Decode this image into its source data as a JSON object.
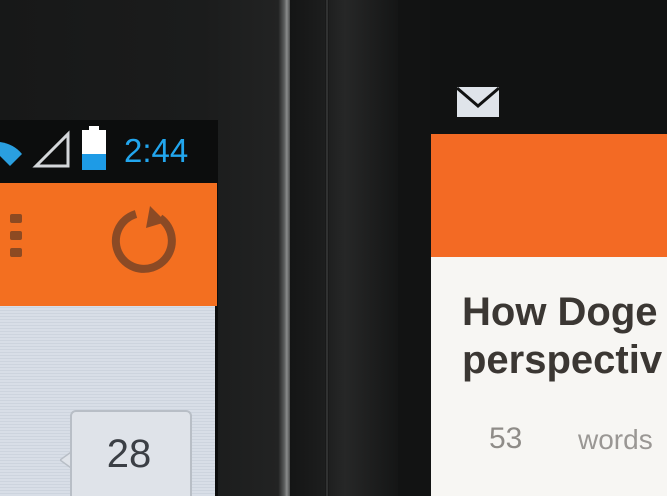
{
  "left_phone": {
    "status_bar": {
      "time": "2:44",
      "icons": [
        "wifi-icon",
        "signal-icon",
        "battery-icon"
      ],
      "time_color": "#22a6ee"
    },
    "toolbar": {
      "color": "#f36f20",
      "icons": [
        "overflow-menu-icon",
        "refresh-icon"
      ]
    },
    "count_badge": {
      "value": "28"
    }
  },
  "right_phone": {
    "status_bar": {
      "icons": [
        "mail-icon"
      ]
    },
    "toolbar": {
      "color": "#f36a24"
    },
    "article": {
      "title_line1": "How Doge",
      "title_line2": "perspectiv",
      "word_count": "53",
      "word_label": "words"
    }
  }
}
